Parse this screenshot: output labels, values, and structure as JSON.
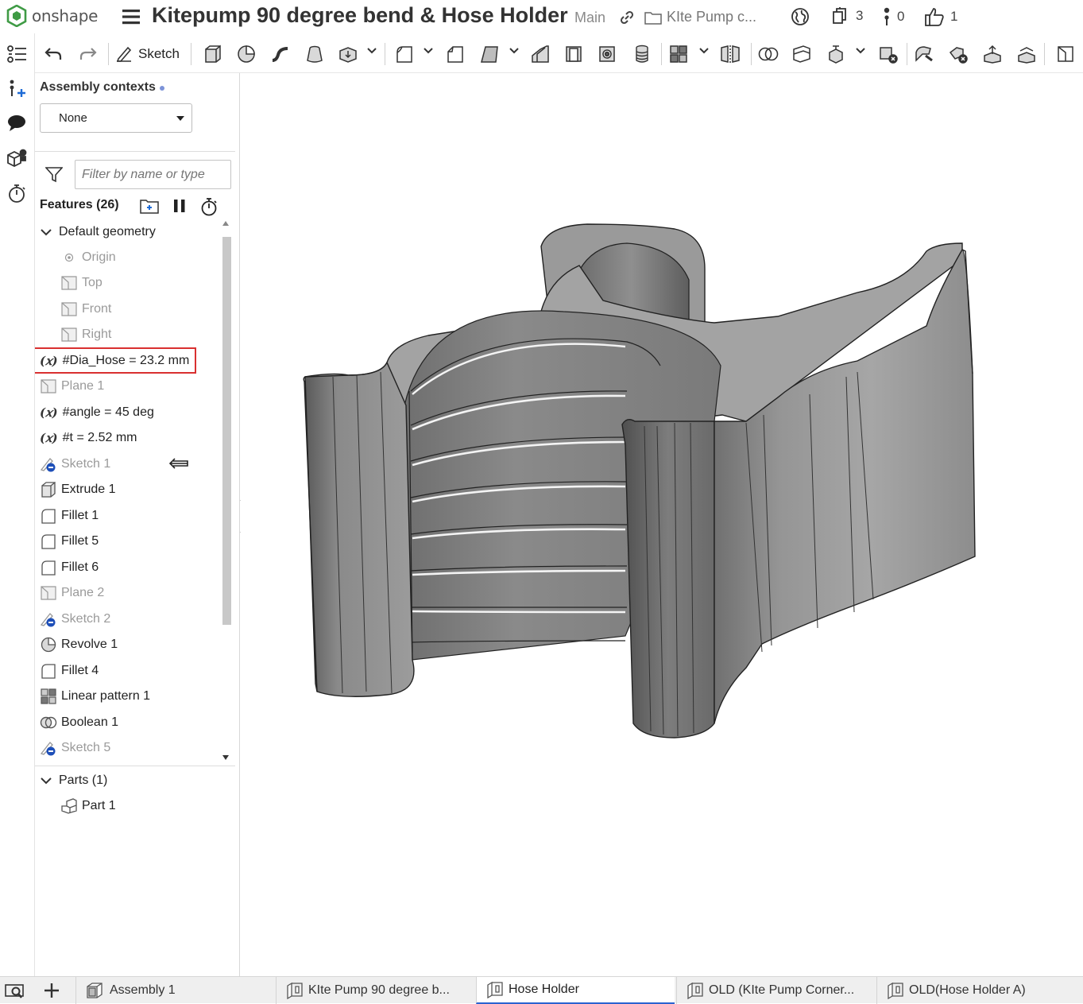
{
  "header": {
    "brand": "onshape",
    "document_title": "Kitepump 90 degree bend & Hose Holder",
    "branch": "Main",
    "folder": "KIte Pump c...",
    "versions_count": "3",
    "branches_count": "0",
    "likes_count": "1"
  },
  "rail": {
    "icons": [
      "feature-list-icon",
      "variables-icon",
      "comments-icon",
      "appearances-icon",
      "performance-icon"
    ]
  },
  "toolbar": {
    "sketch_label": "Sketch",
    "icons": [
      "undo-icon",
      "redo-icon",
      "sketch-icon",
      "extrude-icon",
      "revolve-icon",
      "sweep-icon",
      "loft-icon",
      "thicken-icon",
      "fillet-icon",
      "chamfer-icon",
      "draft-icon",
      "rib-icon",
      "shell-icon",
      "hole-icon",
      "thread-icon",
      "pattern-icon",
      "mirror-icon",
      "boolean-icon",
      "split-icon",
      "transform-icon",
      "delete-part-icon",
      "modify-fillet-icon",
      "delete-face-icon",
      "move-face-icon",
      "replace-face-icon",
      "plane-icon"
    ]
  },
  "panel": {
    "contexts_label": "Assembly contexts",
    "contexts_value": "None",
    "filter_placeholder": "Filter by name or type",
    "features_label": "Features (26)",
    "default_geometry": "Default geometry",
    "default_items": [
      {
        "label": "Origin",
        "icon": "origin-icon"
      },
      {
        "label": "Top",
        "icon": "plane-icon"
      },
      {
        "label": "Front",
        "icon": "plane-icon"
      },
      {
        "label": "Right",
        "icon": "plane-icon"
      }
    ],
    "features": [
      {
        "label": "#Dia_Hose = 23.2 mm",
        "icon": "variable-icon",
        "kind": "var"
      },
      {
        "label": "Plane 1",
        "icon": "plane-icon",
        "kind": "dim"
      },
      {
        "label": "#angle = 45 deg",
        "icon": "variable-icon",
        "kind": "var"
      },
      {
        "label": "#t = 2.52 mm",
        "icon": "variable-icon",
        "kind": "var"
      },
      {
        "label": "Sketch 1",
        "icon": "sketch-icon",
        "kind": "dim"
      },
      {
        "label": "Extrude 1",
        "icon": "extrude-icon",
        "kind": "normal"
      },
      {
        "label": "Fillet 1",
        "icon": "fillet-icon",
        "kind": "normal"
      },
      {
        "label": "Fillet 5",
        "icon": "fillet-icon",
        "kind": "normal"
      },
      {
        "label": "Fillet 6",
        "icon": "fillet-icon",
        "kind": "normal"
      },
      {
        "label": "Plane 2",
        "icon": "plane-icon",
        "kind": "dim"
      },
      {
        "label": "Sketch 2",
        "icon": "sketch-icon",
        "kind": "dim"
      },
      {
        "label": "Revolve 1",
        "icon": "revolve-icon",
        "kind": "normal"
      },
      {
        "label": "Fillet 4",
        "icon": "fillet-icon",
        "kind": "normal"
      },
      {
        "label": "Linear pattern 1",
        "icon": "pattern-icon",
        "kind": "normal"
      },
      {
        "label": "Boolean 1",
        "icon": "boolean-icon",
        "kind": "normal"
      },
      {
        "label": "Sketch 5",
        "icon": "sketch-icon",
        "kind": "dim"
      }
    ],
    "parts_label": "Parts (1)",
    "parts": [
      "Part 1"
    ]
  },
  "tabs": [
    {
      "label": "Assembly 1",
      "icon": "assembly-icon",
      "active": false
    },
    {
      "label": "KIte Pump 90 degree b...",
      "icon": "part-studio-icon",
      "active": false
    },
    {
      "label": "Hose Holder",
      "icon": "part-studio-icon",
      "active": true
    },
    {
      "label": "OLD (KIte Pump Corner...",
      "icon": "part-studio-icon",
      "active": false
    },
    {
      "label": "OLD(Hose Holder A)",
      "icon": "part-studio-icon",
      "active": false
    }
  ],
  "colors": {
    "brand_green": "#3f9b45",
    "highlight_red": "#d93030",
    "active_tab_blue": "#2a62d0",
    "sketch_badge_blue": "#1e4fb8"
  }
}
